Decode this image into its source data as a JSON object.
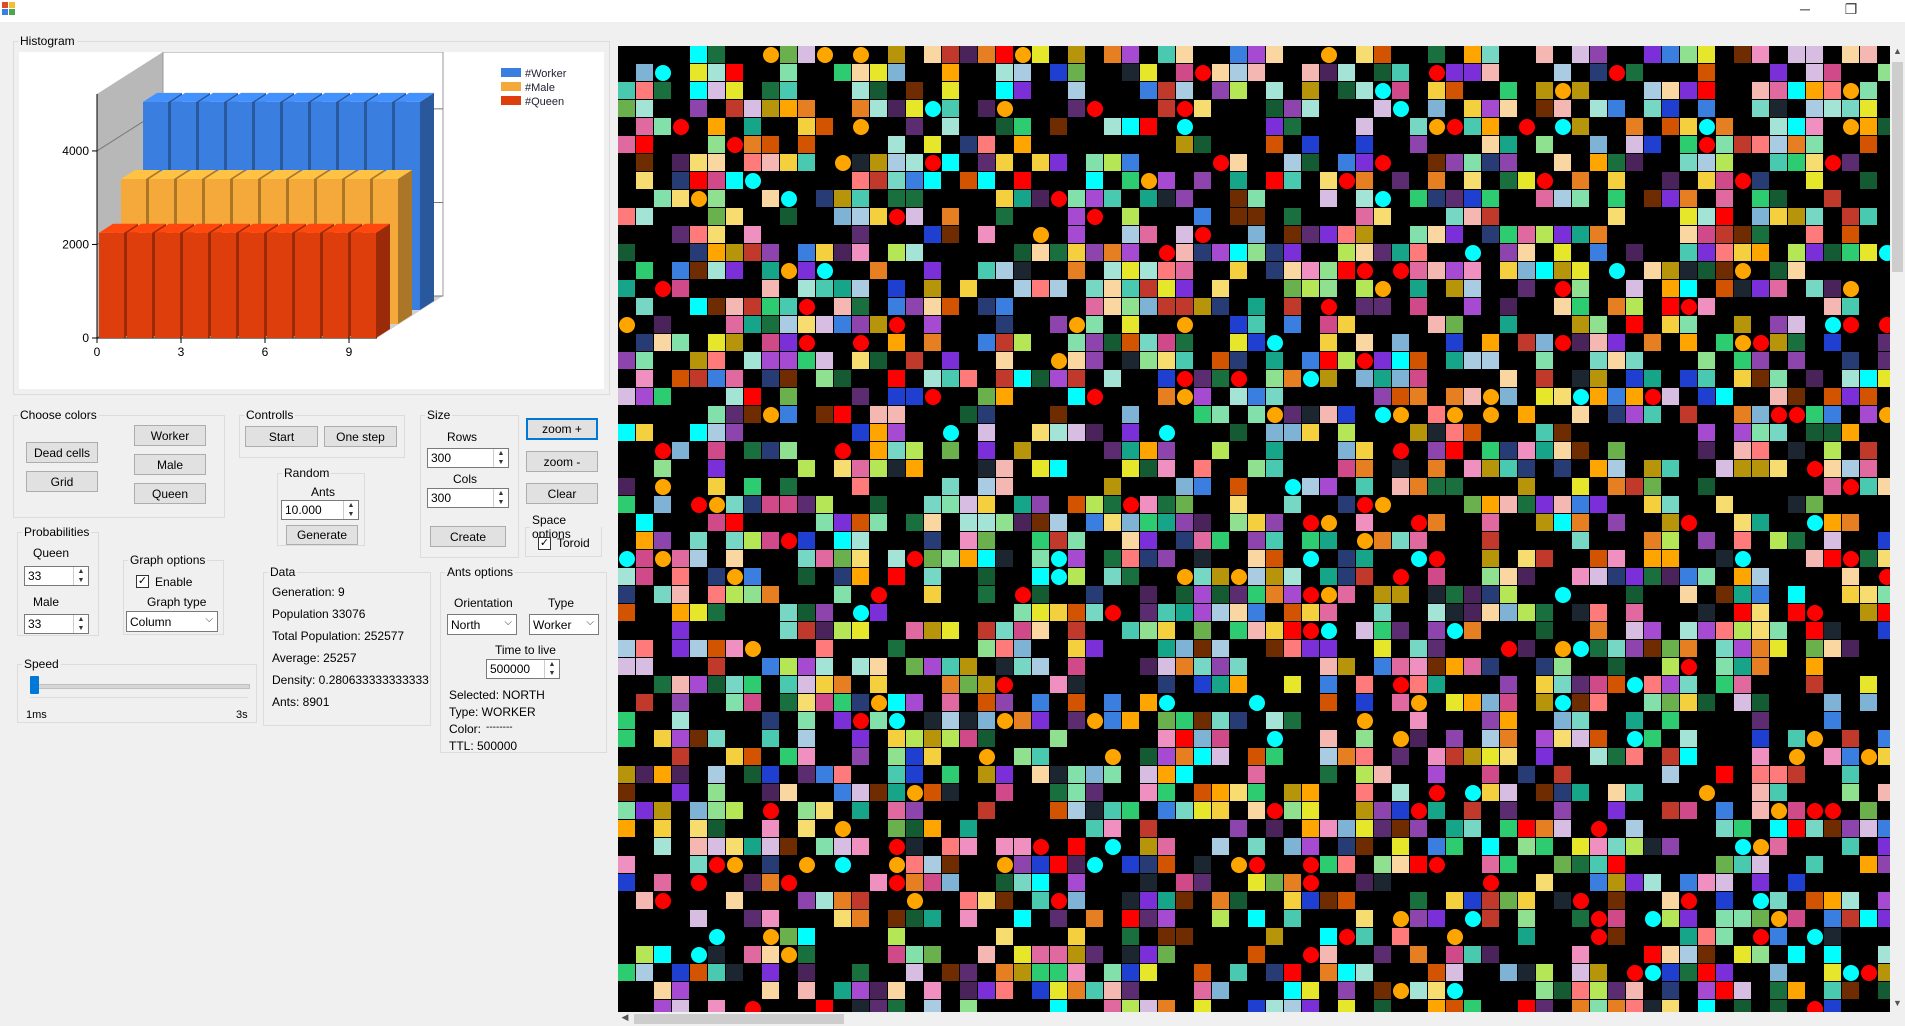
{
  "window": {
    "minimize_glyph": "─",
    "restore_glyph": "❐",
    "colors": {
      "bg": "#f0f0f0",
      "grid_bg": "#000000",
      "focus": "#0078d7"
    }
  },
  "histogram": {
    "title": "Histogram",
    "chart_data": {
      "type": "bar",
      "title": "",
      "xlabel": "",
      "ylabel": "",
      "x_ticks": [
        "0",
        "3",
        "6",
        "9"
      ],
      "y_ticks": [
        "0",
        "2000",
        "4000"
      ],
      "ylim": [
        0,
        4800
      ],
      "categories": [
        "0",
        "1",
        "2",
        "3",
        "4",
        "5",
        "6",
        "7",
        "8",
        "9"
      ],
      "series": [
        {
          "name": "#Worker",
          "color": "#3a7ee0",
          "values": [
            4450,
            4450,
            4450,
            4450,
            4450,
            4450,
            4450,
            4450,
            4450,
            4450
          ]
        },
        {
          "name": "#Male",
          "color": "#f5a93a",
          "values": [
            3100,
            3100,
            3100,
            3100,
            3100,
            3100,
            3100,
            3100,
            3100,
            3100
          ]
        },
        {
          "name": "#Queen",
          "color": "#de3e0c",
          "values": [
            2250,
            2250,
            2250,
            2250,
            2250,
            2250,
            2250,
            2250,
            2250,
            2250
          ]
        }
      ],
      "grid": true,
      "legend_position": "top-right",
      "three_d": true
    }
  },
  "choose_colors": {
    "title": "Choose colors",
    "dead_cells": "Dead cells",
    "grid": "Grid",
    "worker": "Worker",
    "male": "Male",
    "queen": "Queen"
  },
  "controls": {
    "title": "Controlls",
    "start": "Start",
    "one_step": "One step"
  },
  "random": {
    "title": "Random",
    "ants_label": "Ants",
    "ants_value": "10.000",
    "generate": "Generate"
  },
  "size": {
    "title": "Size",
    "rows_label": "Rows",
    "rows_value": "300",
    "cols_label": "Cols",
    "cols_value": "300",
    "create": "Create"
  },
  "zoom": {
    "zoom_in": "zoom +",
    "zoom_out": "zoom -",
    "clear": "Clear"
  },
  "space_options": {
    "title": "Space options",
    "toroid_label": "Toroid",
    "toroid_checked": true
  },
  "probabilities": {
    "title": "Probabilities",
    "queen_label": "Queen",
    "queen_value": "33",
    "male_label": "Male",
    "male_value": "33"
  },
  "graph_options": {
    "title": "Graph options",
    "enable_label": "Enable",
    "enable_checked": true,
    "graph_type_label": "Graph type",
    "graph_type_value": "Column"
  },
  "speed": {
    "title": "Speed",
    "min_label": "1ms",
    "max_label": "3s",
    "value_fraction": 0.0
  },
  "data": {
    "title": "Data",
    "generation": "Generation: 9",
    "population": "Population 33076",
    "total_population": "Total Population: 252577",
    "average": "Average: 25257",
    "density": "Density: 0.280633333333333",
    "ants": "Ants: 8901"
  },
  "ants_options": {
    "title": "Ants options",
    "orientation_label": "Orientation",
    "orientation_value": "North",
    "type_label": "Type",
    "type_value": "Worker",
    "ttl_label": "Time to live",
    "ttl_value": "500000",
    "selected": "Selected: NORTH",
    "type_info": "Type: WORKER",
    "color_info": "Color:",
    "color_swatch": "--------",
    "ttl_info": "TTL: 500000"
  },
  "grid_canvas": {
    "palette": [
      "#ff0000",
      "#ffa500",
      "#00ffff",
      "#3a7ee0",
      "#1f3fd0",
      "#7b2fd8",
      "#a64ad2",
      "#d04a8a",
      "#e06aa0",
      "#f090c0",
      "#ff7a7a",
      "#c0392b",
      "#2ecc71",
      "#17a589",
      "#48c9b0",
      "#8fe08f",
      "#b5e655",
      "#6ab04c",
      "#f4d03f",
      "#e6e62a",
      "#e67e22",
      "#d35400",
      "#8e44ad",
      "#5b2c6f",
      "#273c75",
      "#1b2631",
      "#4a235a",
      "#145a32",
      "#196f3d",
      "#76d7c4",
      "#a3e4d7",
      "#f5b7b1",
      "#fad7a0",
      "#d7bde2",
      "#a9cce3",
      "#7fb3d5",
      "#b7950b",
      "#6e2c00",
      "#f7dc6f",
      "#82e0aa"
    ]
  }
}
